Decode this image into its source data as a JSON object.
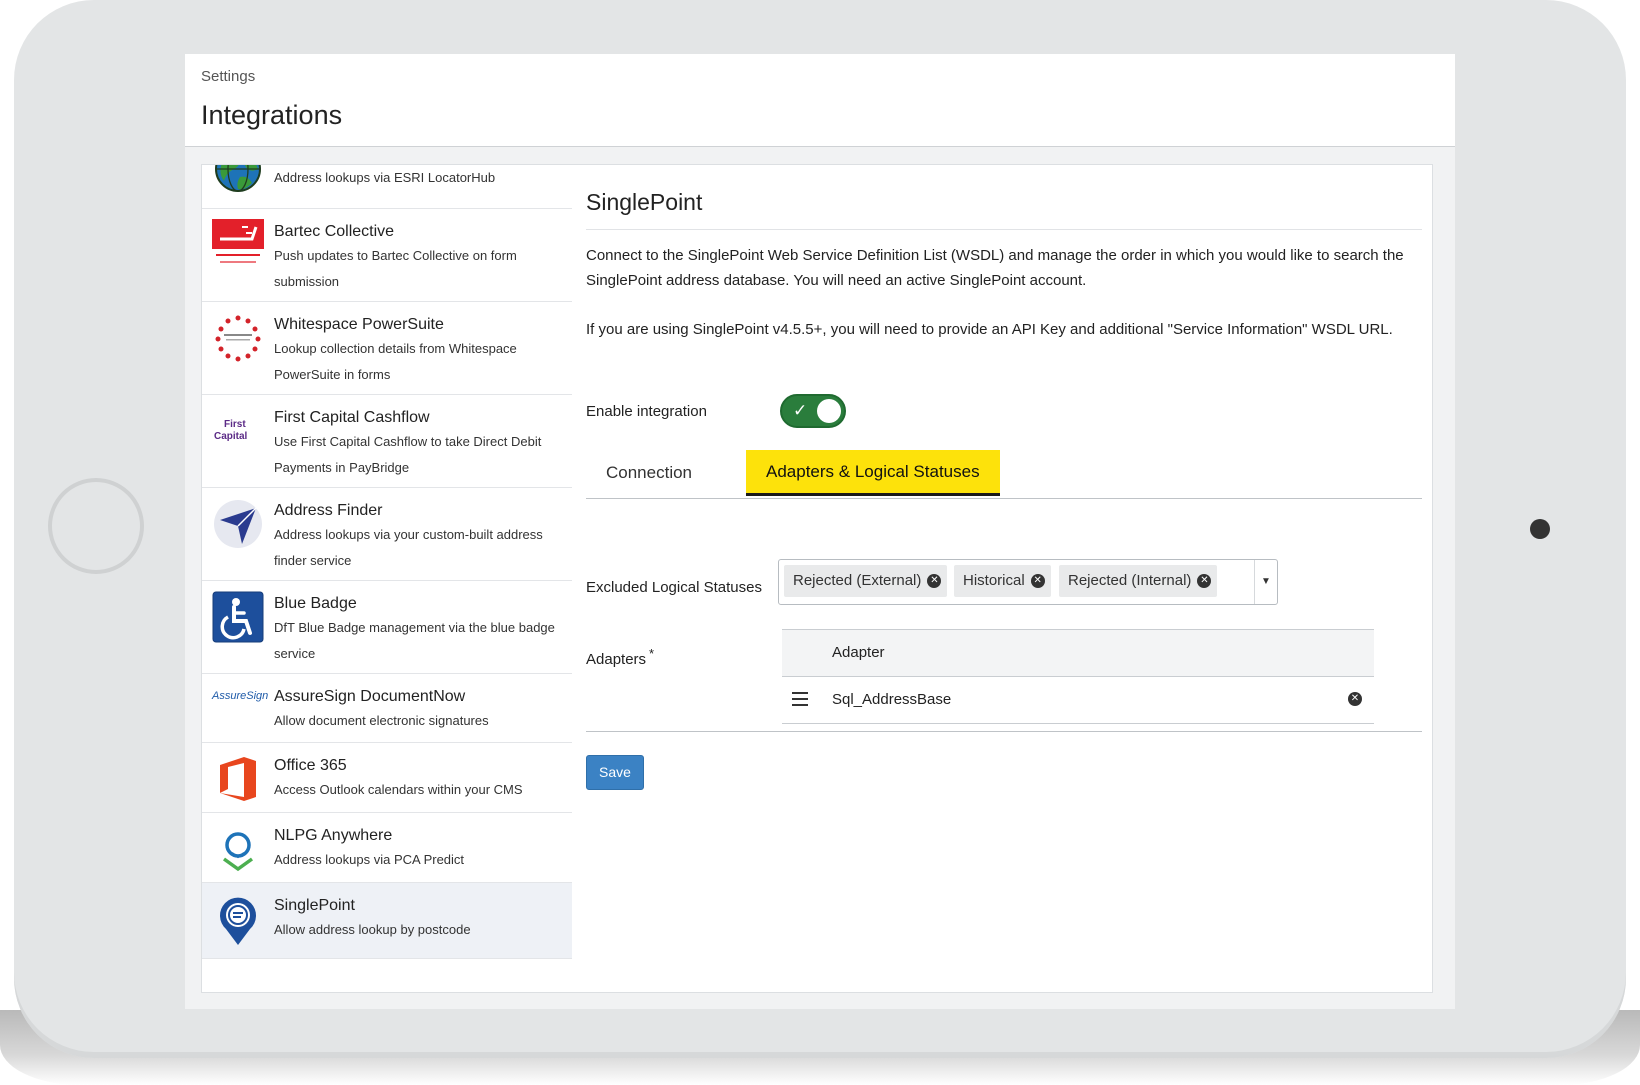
{
  "header": {
    "breadcrumb": "Settings",
    "title": "Integrations"
  },
  "sidebar": {
    "items": [
      {
        "name": "",
        "description": "Address lookups via ESRI LocatorHub",
        "icon": "globe-icon"
      },
      {
        "name": "Bartec Collective",
        "description": "Push updates to Bartec Collective on form submission",
        "icon": "bartec-logo-icon"
      },
      {
        "name": "Whitespace PowerSuite",
        "description": "Lookup collection details from Whitespace PowerSuite in forms",
        "icon": "whitespace-logo-icon"
      },
      {
        "name": "First Capital Cashflow",
        "description": "Use First Capital Cashflow to take Direct Debit Payments in PayBridge",
        "icon": "first-capital-logo-icon",
        "logo_text_1": "First",
        "logo_text_2": "Capital"
      },
      {
        "name": "Address Finder",
        "description": "Address lookups via your custom-built address finder service",
        "icon": "address-finder-icon"
      },
      {
        "name": "Blue Badge",
        "description": "DfT Blue Badge management via the blue badge service",
        "icon": "wheelchair-icon"
      },
      {
        "name": "AssureSign DocumentNow",
        "description": "Allow document electronic signatures",
        "icon": "assuresign-logo-icon",
        "logo_text": "AssureSign"
      },
      {
        "name": "Office 365",
        "description": "Access Outlook calendars within your CMS",
        "icon": "office-logo-icon"
      },
      {
        "name": "NLPG Anywhere",
        "description": "Address lookups via PCA Predict",
        "icon": "nlpg-logo-icon"
      },
      {
        "name": "SinglePoint",
        "description": "Allow address lookup by postcode",
        "icon": "map-pin-icon"
      }
    ]
  },
  "detail": {
    "title": "SinglePoint",
    "description_1": "Connect to the SinglePoint Web Service Definition List (WSDL) and manage the order in which you would like to search the SinglePoint address database. You will need an active SinglePoint account.",
    "description_2": "If you are using SinglePoint v4.5.5+, you will need to provide an API Key and additional \"Service Information\" WSDL URL.",
    "enable_label": "Enable integration",
    "enabled": true,
    "tabs": [
      {
        "label": "Connection",
        "active": false
      },
      {
        "label": "Adapters & Logical Statuses",
        "active": true
      }
    ],
    "excluded_label": "Excluded Logical Statuses",
    "excluded_statuses": [
      "Rejected (External)",
      "Historical",
      "Rejected (Internal)"
    ],
    "adapters_label": "Adapters",
    "adapters_required_mark": "*",
    "adapter_column": "Adapter",
    "adapters": [
      "Sql_AddressBase"
    ],
    "save_label": "Save"
  },
  "colors": {
    "accent_tab": "#fde20b",
    "toggle_on": "#2a7d3c",
    "save_button": "#3b82c4"
  }
}
